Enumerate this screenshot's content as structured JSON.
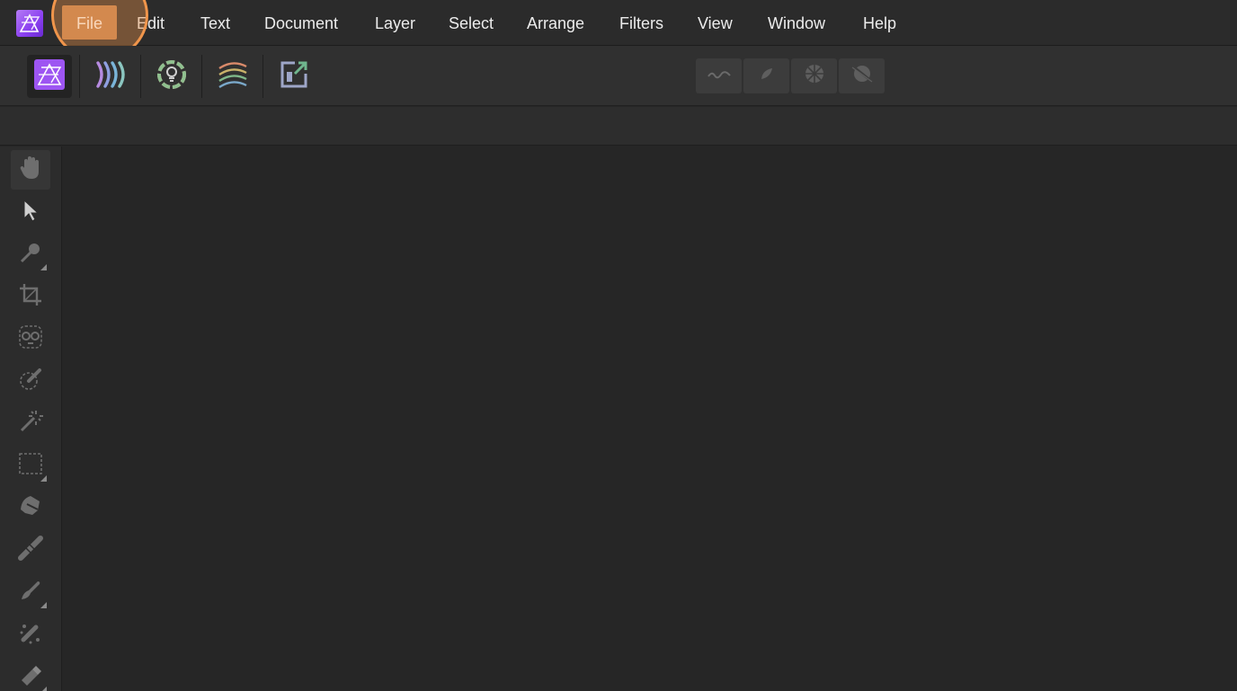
{
  "menubar": {
    "app_icon": "affinity-photo-logo-icon",
    "items": [
      {
        "label": "File"
      },
      {
        "label": "Edit"
      },
      {
        "label": "Text"
      },
      {
        "label": "Document"
      },
      {
        "label": "Layer"
      },
      {
        "label": "Select"
      },
      {
        "label": "Arrange"
      },
      {
        "label": "Filters"
      },
      {
        "label": "View"
      },
      {
        "label": "Window"
      },
      {
        "label": "Help"
      }
    ],
    "highlighted_item": "File"
  },
  "personas": [
    {
      "icon": "photo-persona-icon",
      "active": true
    },
    {
      "icon": "liquify-persona-icon",
      "active": false
    },
    {
      "icon": "develop-persona-icon",
      "active": false
    },
    {
      "icon": "tone-mapping-persona-icon",
      "active": false
    },
    {
      "icon": "export-persona-icon",
      "active": false
    }
  ],
  "quick_buttons": [
    {
      "icon": "auto-levels-icon"
    },
    {
      "icon": "auto-contrast-icon"
    },
    {
      "icon": "auto-colors-icon"
    },
    {
      "icon": "auto-white-balance-icon"
    }
  ],
  "tools": [
    {
      "icon": "hand-tool-icon"
    },
    {
      "icon": "move-tool-icon"
    },
    {
      "icon": "color-picker-tool-icon"
    },
    {
      "icon": "crop-tool-icon"
    },
    {
      "icon": "red-eye-tool-icon"
    },
    {
      "icon": "selection-brush-tool-icon"
    },
    {
      "icon": "flood-select-tool-icon"
    },
    {
      "icon": "rectangular-marquee-tool-icon"
    },
    {
      "icon": "freehand-selection-tool-icon"
    },
    {
      "icon": "paint-brush-tool-icon"
    },
    {
      "icon": "pixel-tool-icon"
    },
    {
      "icon": "clone-brush-tool-icon"
    },
    {
      "icon": "erase-brush-tool-icon"
    }
  ],
  "colors": {
    "accent_highlight": "#f0954b",
    "file_menu_bg": "#c2814f",
    "brand_purple": "#8a3ff0"
  }
}
